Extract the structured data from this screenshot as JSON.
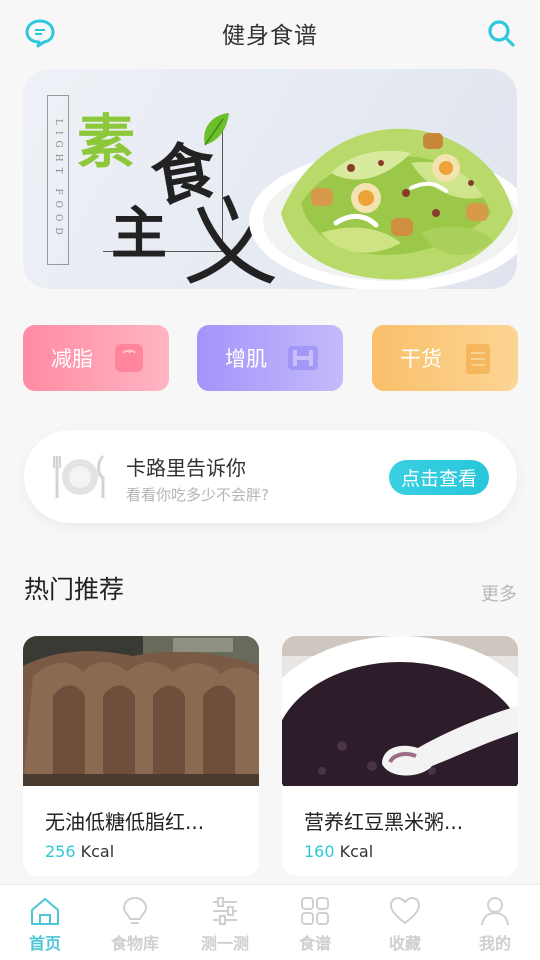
{
  "header": {
    "title": "健身食谱",
    "left_icon": "chat-bubble-icon",
    "right_icon": "search-icon",
    "accent_color": "#2dc8db"
  },
  "banner": {
    "vertical_label": "LIGHT FOOD",
    "char_1": "素",
    "char_2": "主",
    "char_3": "食",
    "char_4": "义"
  },
  "categories": [
    {
      "label": "减脂",
      "icon": "scale-icon",
      "color": "#ff8ba4"
    },
    {
      "label": "增肌",
      "icon": "dumbbell-icon",
      "color": "#a394fa"
    },
    {
      "label": "干货",
      "icon": "notepad-icon",
      "color": "#f9bf6a"
    }
  ],
  "calorie_card": {
    "title": "卡路里告诉你",
    "subtitle": "看看你吃多少不会胖?",
    "button_label": "点击查看",
    "icon": "plate-cutlery-icon"
  },
  "hot_section": {
    "title": "热门推荐",
    "more_label": "更多"
  },
  "recipes": [
    {
      "name": "无油低糖低脂红...",
      "kcal": "256",
      "unit": "Kcal"
    },
    {
      "name": "营养红豆黑米粥...",
      "kcal": "160",
      "unit": "Kcal"
    }
  ],
  "nav": [
    {
      "label": "首页",
      "icon": "home-icon",
      "active": true
    },
    {
      "label": "食物库",
      "icon": "lightbulb-icon",
      "active": false
    },
    {
      "label": "测一测",
      "icon": "sliders-icon",
      "active": false
    },
    {
      "label": "食谱",
      "icon": "grid-icon",
      "active": false
    },
    {
      "label": "收藏",
      "icon": "heart-icon",
      "active": false
    },
    {
      "label": "我的",
      "icon": "user-icon",
      "active": false
    }
  ]
}
